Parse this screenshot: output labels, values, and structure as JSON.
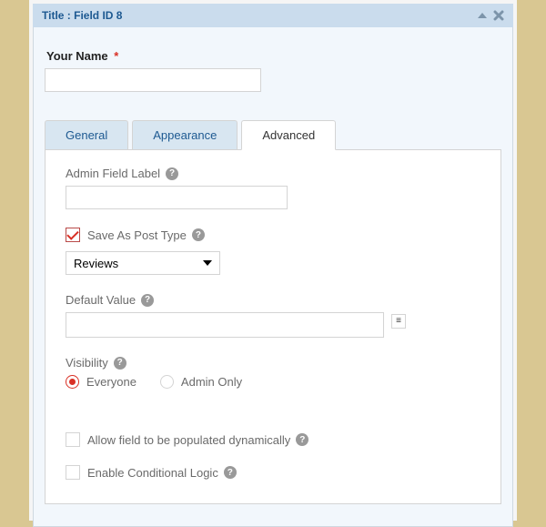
{
  "header": {
    "title": "Title : Field ID 8"
  },
  "preview": {
    "label": "Your Name",
    "required_mark": "*",
    "value": ""
  },
  "tabs": {
    "general": "General",
    "appearance": "Appearance",
    "advanced": "Advanced",
    "active": "advanced"
  },
  "advanced": {
    "admin_field_label": {
      "label": "Admin Field Label",
      "value": ""
    },
    "save_as_post_type": {
      "checked": true,
      "label": "Save As Post Type",
      "selected": "Reviews"
    },
    "default_value": {
      "label": "Default Value",
      "value": ""
    },
    "visibility": {
      "label": "Visibility",
      "selected": "everyone",
      "options": {
        "everyone": "Everyone",
        "admin_only": "Admin Only"
      }
    },
    "populate_dynamically": {
      "checked": false,
      "label": "Allow field to be populated dynamically"
    },
    "conditional_logic": {
      "checked": false,
      "label": "Enable Conditional Logic"
    }
  }
}
